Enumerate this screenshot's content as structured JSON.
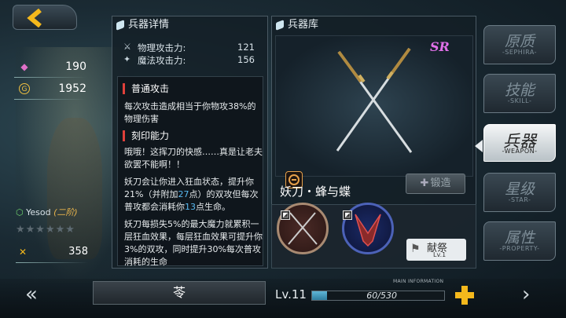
{
  "left_stats": {
    "crystal": {
      "icon": "crystal-icon",
      "value": "190"
    },
    "coin": {
      "icon": "coin-icon",
      "value": "1952"
    },
    "unit_name": "Yesod",
    "unit_rank": "(二阶)",
    "power": {
      "icon": "cross-swords-icon",
      "value": "358"
    }
  },
  "detail": {
    "title": "兵器详情",
    "phys_label": "物理攻击力:",
    "phys_value": "121",
    "magic_label": "魔法攻击力:",
    "magic_value": "156",
    "normal_attack_title": "普通攻击",
    "normal_attack_text": "每次攻击造成相当于你物攻38%的物理伤害",
    "imprint_title": "刻印能力",
    "imprint_quote": "哦哦！这挥刀的快感……真是让老夫欲罢不能啊！！",
    "imprint_p1_a": "妖刀会让你进入狂血状态，提升你21%（并附加",
    "imprint_p1_hl1": "27",
    "imprint_p1_b": "点）的双攻但每次普攻都会消耗你",
    "imprint_p1_hl2": "13",
    "imprint_p1_c": "点生命。",
    "imprint_p2": "妖刀每损失5%的最大魔力就累积一层狂血效果，每层狂血效果可提升你3%的双攻，同时提升30%每次普攻消耗的生命"
  },
  "armory": {
    "title": "兵器库",
    "rarity": "SR",
    "weapon_name": "妖刀・蜂与蝶",
    "forge_label": "锻造",
    "offer_label": "献祭",
    "offer_level": "Lv.1"
  },
  "tabs": [
    {
      "label": "原质",
      "sub": "-SEPHIRA-",
      "active": false
    },
    {
      "label": "技能",
      "sub": "-SKILL-",
      "active": false
    },
    {
      "label": "兵器",
      "sub": "-WEAPON-",
      "active": true
    },
    {
      "label": "星级",
      "sub": "-STAR-",
      "active": false
    },
    {
      "label": "属性",
      "sub": "-PROPERTY-",
      "active": false
    }
  ],
  "bottom": {
    "character_name": "苓",
    "level": "Lv.11",
    "xp_text": "60/530",
    "xp_fraction": 0.113,
    "main_information": "MAIN INFORMATION"
  },
  "colors": {
    "accent_gold": "#f4b81c",
    "highlight_blue": "#58b8f0",
    "rarity_pink": "#e070e8",
    "section_red": "#e0403a"
  }
}
